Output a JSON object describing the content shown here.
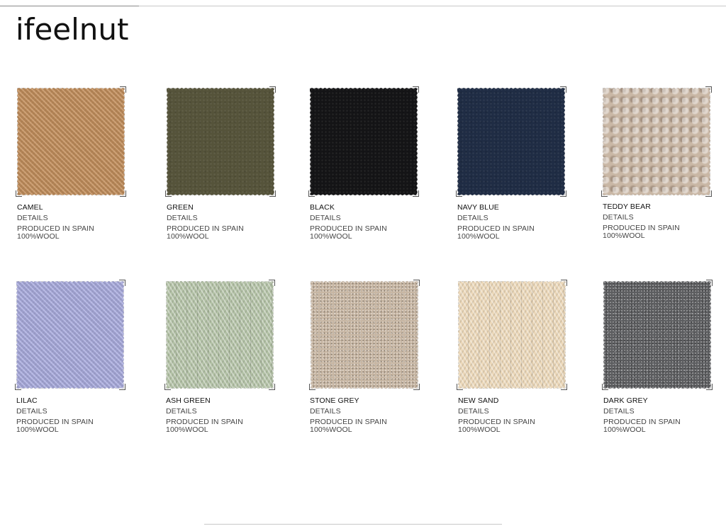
{
  "brand": {
    "name": "ifeelnut"
  },
  "swatches": [
    {
      "name": "CAMEL",
      "details": "DETAILS",
      "origin": "PRODUCED IN SPAIN",
      "composition": "100%WOOL",
      "color": "#c6925f",
      "texture": "twill"
    },
    {
      "name": "GREEN",
      "details": "DETAILS",
      "origin": "PRODUCED IN SPAIN",
      "composition": "100%WOOL",
      "color": "#55533a",
      "texture": "flannel"
    },
    {
      "name": "BLACK",
      "details": "DETAILS",
      "origin": "PRODUCED IN SPAIN",
      "composition": "100%WOOL",
      "color": "#141416",
      "texture": "flannel"
    },
    {
      "name": "NAVY BLUE",
      "details": "DETAILS",
      "origin": "PRODUCED IN SPAIN",
      "composition": "100%WOOL",
      "color": "#1f2c44",
      "texture": "flannel"
    },
    {
      "name": "TEDDY BEAR",
      "details": "DETAILS",
      "origin": "PRODUCED IN SPAIN",
      "composition": "100%WOOL",
      "color": "#c9b7a5",
      "texture": "boucle"
    },
    {
      "name": "LILAC",
      "details": "DETAILS",
      "origin": "PRODUCED IN SPAIN",
      "composition": "100%WOOL",
      "color": "#aeb0e2",
      "texture": "twill"
    },
    {
      "name": "ASH GREEN",
      "details": "DETAILS",
      "origin": "PRODUCED IN SPAIN",
      "composition": "100%WOOL",
      "color": "#b3c2a6",
      "texture": "herring-cols"
    },
    {
      "name": "STONE GREY",
      "details": "DETAILS",
      "origin": "PRODUCED IN SPAIN",
      "composition": "100%WOOL",
      "color": "#c7b6a3",
      "texture": "tweed"
    },
    {
      "name": "NEW SAND",
      "details": "DETAILS",
      "origin": "PRODUCED IN SPAIN",
      "composition": "100%WOOL",
      "color": "#ecd8b9",
      "texture": "herring-cols"
    },
    {
      "name": "DARK GREY",
      "details": "DETAILS",
      "origin": "PRODUCED IN SPAIN",
      "composition": "100%WOOL",
      "color": "#5c5d60",
      "texture": "tweed"
    }
  ]
}
